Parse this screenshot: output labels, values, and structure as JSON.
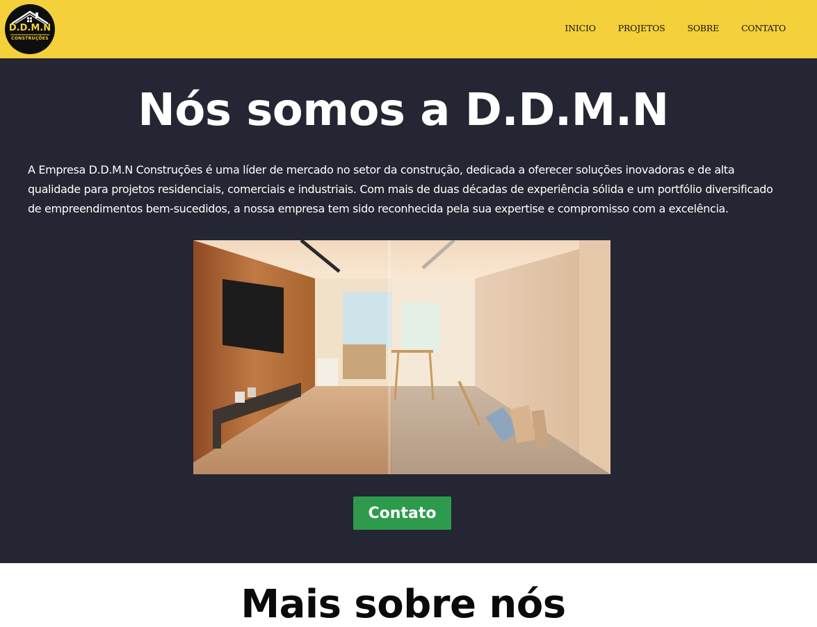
{
  "logo": {
    "title": "D.D.M.N",
    "subtitle": "CONSTRUÇÕES",
    "icon": "house-roof-icon"
  },
  "nav": {
    "items": [
      {
        "label": "INICIO"
      },
      {
        "label": "PROJETOS"
      },
      {
        "label": "SOBRE"
      },
      {
        "label": "CONTATO"
      }
    ]
  },
  "hero": {
    "title": "Nós somos a D.D.M.N",
    "text": "A Empresa D.D.M.N Construções é uma líder de mercado no setor da construção, dedicada a oferecer soluções inovadoras e de alta qualidade para projetos residenciais, comerciais e industriais. Com mais de duas décadas de experiência sólida e um portfólio diversificado de empreendimentos bem-sucedidos, a nossa empresa tem sido reconhecida pela sua expertise e compromisso com a excelência.",
    "image": "before-after-renovation-photo",
    "button_label": "Contato"
  },
  "about": {
    "title": "Mais sobre nós"
  },
  "colors": {
    "header": "#f4d03a",
    "hero_bg": "#242633",
    "button": "#2e9a4b",
    "text_light": "#ffffff"
  }
}
